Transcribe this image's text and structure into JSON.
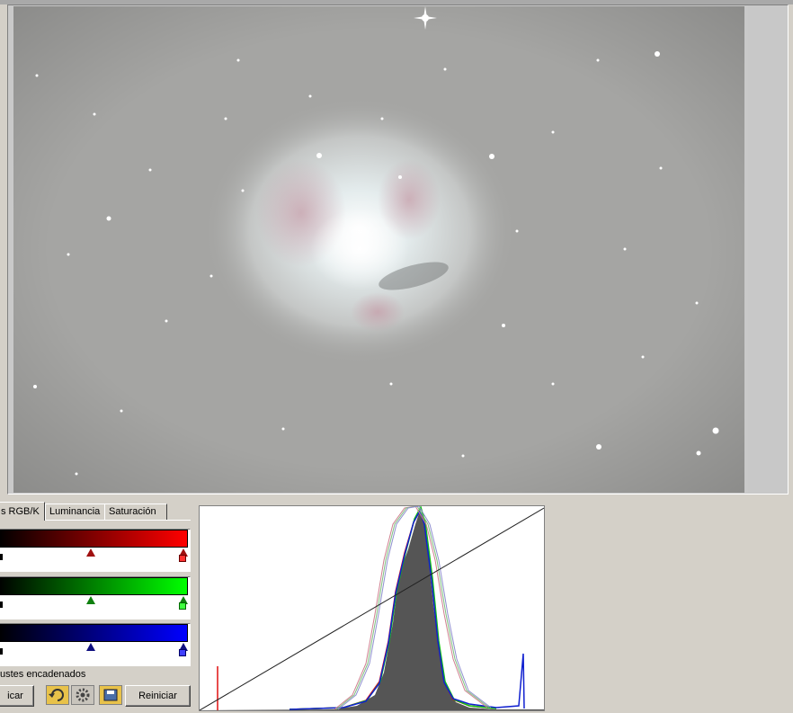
{
  "tabs": [
    {
      "label": "s RGB/K",
      "active": true
    },
    {
      "label": "Luminancia",
      "active": false
    },
    {
      "label": "Saturación",
      "active": false
    }
  ],
  "channels": [
    {
      "name": "red",
      "color": "#ff0000",
      "dark": "#a01010",
      "mid_level": 0.5,
      "white_level": 1.0
    },
    {
      "name": "green",
      "color": "#00ff00",
      "dark": "#108010",
      "mid_level": 0.5,
      "white_level": 1.0
    },
    {
      "name": "blue",
      "color": "#0000ff",
      "dark": "#101080",
      "mid_level": 0.5,
      "white_level": 1.0
    }
  ],
  "chain_checkbox_label": "ustes encadenados",
  "buttons": {
    "apply_label": "icar",
    "reset_label": "Reiniciar"
  },
  "icons": [
    "undo-icon",
    "settings-icon",
    "save-icon"
  ],
  "colors": {
    "window_bg": "#d4d0c8",
    "histogram_gray": "#555555"
  }
}
